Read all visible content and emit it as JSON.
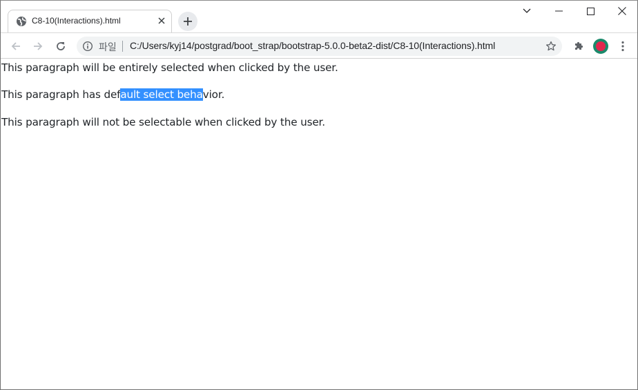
{
  "browser": {
    "tab": {
      "title": "C8-10(Interactions).html"
    },
    "window_controls": {
      "minimize_icon": "minimize-icon",
      "maximize_icon": "maximize-icon",
      "close_icon": "close-icon"
    },
    "toolbar": {
      "scheme_label": "파일",
      "url": "C:/Users/kyj14/postgrad/boot_strap/bootstrap-5.0.0-beta2-dist/C8-10(Interactions).html"
    },
    "colors": {
      "profile_ring": "#1b8a6b",
      "profile_fill": "#e2264d",
      "selection": "#3390ff"
    }
  },
  "page": {
    "paragraph_all": "This paragraph will be entirely selected when clicked by the user.",
    "paragraph_auto": {
      "before": "This paragraph has def",
      "selected": "ault select beha",
      "after": "vior."
    },
    "paragraph_none": "This paragraph will not be selectable when clicked by the user."
  }
}
